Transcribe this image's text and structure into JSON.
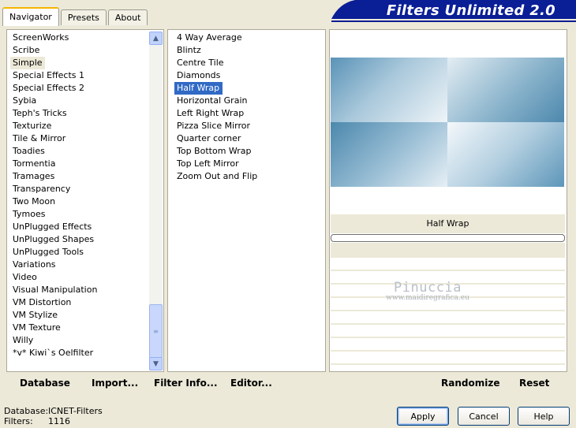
{
  "tabs": [
    {
      "label": "Navigator",
      "active": true
    },
    {
      "label": "Presets",
      "active": false
    },
    {
      "label": "About",
      "active": false
    }
  ],
  "banner": {
    "title": "Filters Unlimited 2.0",
    "color": "#0a1e96"
  },
  "categories": [
    "ScreenWorks",
    "Scribe",
    "Simple",
    "Special Effects 1",
    "Special Effects 2",
    "Sybia",
    "Teph's Tricks",
    "Texturize",
    "Tile & Mirror",
    "Toadies",
    "Tormentia",
    "Tramages",
    "Transparency",
    "Two Moon",
    "Tymoes",
    "UnPlugged Effects",
    "UnPlugged Shapes",
    "UnPlugged Tools",
    "Variations",
    "Video",
    "Visual Manipulation",
    "VM Distortion",
    "VM Stylize",
    "VM Texture",
    "Willy",
    "*v* Kiwi`s Oelfilter"
  ],
  "selected_category": "Simple",
  "filters": [
    "4 Way Average",
    "Blintz",
    "Centre Tile",
    "Diamonds",
    "Half Wrap",
    "Horizontal Grain",
    "Left Right Wrap",
    "Pizza Slice Mirror",
    "Quarter corner",
    "Top Bottom Wrap",
    "Top Left Mirror",
    "Zoom Out and Flip"
  ],
  "selected_filter": "Half Wrap",
  "filter_title": "Half Wrap",
  "watermark": {
    "name": "Pinuccia",
    "url": "www.maidiregrafica.eu"
  },
  "toolbar": {
    "database": "Database",
    "import": "Import...",
    "filter_info": "Filter Info...",
    "editor": "Editor...",
    "randomize": "Randomize",
    "reset": "Reset"
  },
  "status": {
    "database_label": "Database:",
    "database_value": "ICNET-Filters",
    "filters_label": "Filters:",
    "filters_value": "1116"
  },
  "buttons": {
    "apply": "Apply",
    "cancel": "Cancel",
    "help": "Help"
  },
  "colors": {
    "selection": "#316ac5",
    "background": "#ece9d8",
    "tab_highlight": "#f5b400"
  }
}
